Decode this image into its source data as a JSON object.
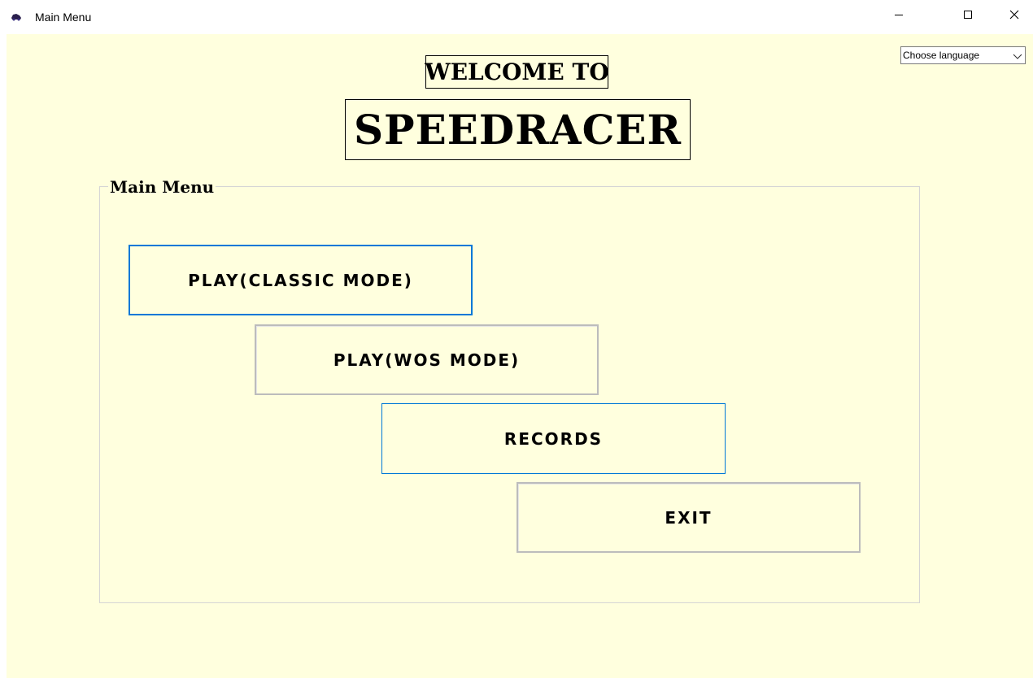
{
  "window": {
    "title": "Main Menu",
    "icon": "car-icon",
    "controls": {
      "minimize": "minimize-icon",
      "maximize": "maximize-icon",
      "close": "close-icon"
    }
  },
  "language": {
    "selected": "Choose language"
  },
  "header": {
    "welcome": "WELCOME TO",
    "brand": "SPEEDRACER"
  },
  "menu": {
    "group_label": "Main Menu",
    "buttons": [
      {
        "label": "PLAY(CLASSIC MODE)"
      },
      {
        "label": "PLAY(WOS MODE)"
      },
      {
        "label": "RECORDS"
      },
      {
        "label": "EXIT"
      }
    ]
  },
  "colors": {
    "background": "#ffffde",
    "focus_border": "#0078d7",
    "button_border": "#bcbcbc"
  }
}
